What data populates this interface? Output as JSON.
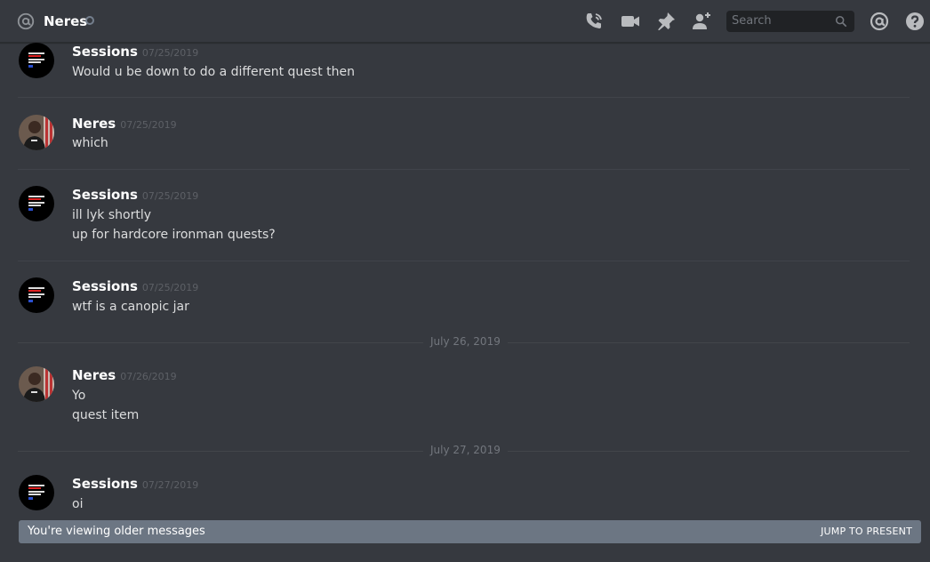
{
  "header": {
    "channel_name": "Neres",
    "search_placeholder": "Search"
  },
  "messages": [
    {
      "author": "Sessions",
      "timestamp": "07/25/2019",
      "lines": [
        "Would u be down to do a different quest then"
      ],
      "avatar": "sessions-avatar"
    },
    {
      "author": "Neres",
      "timestamp": "07/25/2019",
      "lines": [
        "which"
      ],
      "avatar": "neres-avatar"
    },
    {
      "author": "Sessions",
      "timestamp": "07/25/2019",
      "lines": [
        "ill lyk shortly",
        "up for hardcore ironman quests?"
      ],
      "avatar": "sessions-avatar"
    },
    {
      "author": "Sessions",
      "timestamp": "07/25/2019",
      "lines": [
        "wtf is a canopic jar"
      ],
      "avatar": "sessions-avatar"
    },
    {
      "author": "Neres",
      "timestamp": "07/26/2019",
      "lines": [
        "Yo",
        "quest item"
      ],
      "avatar": "neres-avatar"
    },
    {
      "author": "Sessions",
      "timestamp": "07/27/2019",
      "lines": [
        "oi"
      ],
      "avatar": "sessions-avatar"
    }
  ],
  "date_separators": [
    "July 26, 2019",
    "July 27, 2019"
  ],
  "older_bar": {
    "text": "You're viewing older messages",
    "jump_label": "JUMP TO PRESENT"
  },
  "colors": {
    "background": "#36393f",
    "older_bar": "#6c7683",
    "search_bg": "#202225"
  }
}
